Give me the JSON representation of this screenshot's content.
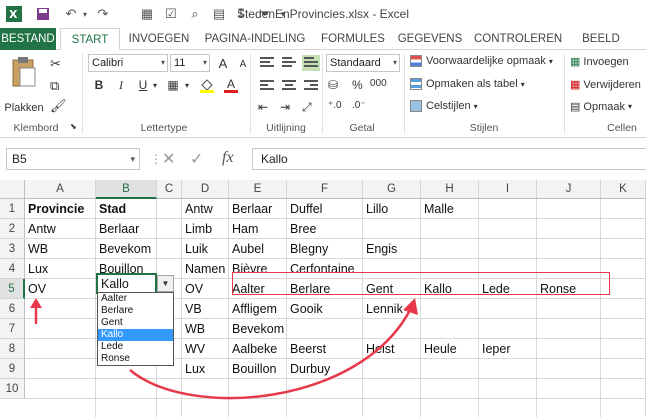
{
  "window": {
    "title": "StedenEnProvincies.xlsx - Excel"
  },
  "qat": {
    "icons": [
      "excel-logo-icon",
      "save-icon",
      "undo-icon",
      "redo-icon",
      "sort-icon",
      "format-icon",
      "preview-icon",
      "paste-special-icon",
      "sort-desc-icon",
      "filter-icon",
      "customize-icon"
    ]
  },
  "tabs": [
    {
      "label": "BESTAND"
    },
    {
      "label": "START"
    },
    {
      "label": "INVOEGEN"
    },
    {
      "label": "PAGINA-INDELING"
    },
    {
      "label": "FORMULES"
    },
    {
      "label": "GEGEVENS"
    },
    {
      "label": "CONTROLEREN"
    },
    {
      "label": "BEELD"
    }
  ],
  "ribbon": {
    "clipboard": {
      "paste_label": "Plakken",
      "group_label": "Klembord"
    },
    "font": {
      "name": "Calibri",
      "size": "11",
      "bold": "B",
      "italic": "I",
      "underline": "U",
      "grow": "A",
      "shrink": "A",
      "fontcolor": "A",
      "group_label": "Lettertype"
    },
    "alignment": {
      "group_label": "Uitlijning"
    },
    "number": {
      "format": "Standaard",
      "percent": "%",
      "thousands": "000",
      "group_label": "Getal"
    },
    "styles": {
      "conditional": "Voorwaardelijke opmaak",
      "as_table": "Opmaken als tabel",
      "cell_styles": "Celstijlen",
      "group_label": "Stijlen"
    },
    "cells": {
      "insert": "Invoegen",
      "delete": "Verwijderen",
      "format": "Opmaak",
      "group_label": "Cellen"
    }
  },
  "formula_bar": {
    "name_box": "B5",
    "fx": "fx",
    "value": "Kallo"
  },
  "columns": [
    "A",
    "B",
    "C",
    "D",
    "E",
    "F",
    "G",
    "H",
    "I",
    "J",
    "K"
  ],
  "rows": [
    "1",
    "2",
    "3",
    "4",
    "5",
    "6",
    "7",
    "8",
    "9",
    "10"
  ],
  "cells": {
    "A": [
      "Provincie",
      "Antw",
      "WB",
      "Lux",
      "OV",
      "",
      "",
      "",
      "",
      ""
    ],
    "B": [
      "Stad",
      "Berlaar",
      "Bevekom",
      "Bouillon",
      "Kallo",
      "",
      "",
      "",
      "",
      ""
    ],
    "D": [
      "Antw",
      "Limb",
      "Luik",
      "Namen",
      "OV",
      "VB",
      "WB",
      "WV",
      "Lux",
      ""
    ],
    "E": [
      "Berlaar",
      "Ham",
      "Aubel",
      "Bièvre",
      "Aalter",
      "Affligem",
      "Bevekom",
      "Aalbeke",
      "Bouillon",
      ""
    ],
    "F": [
      "Duffel",
      "Bree",
      "Blegny",
      "Cerfontaine",
      "Berlare",
      "Gooik",
      "",
      "Beerst",
      "Durbuy",
      ""
    ],
    "G": [
      "Lillo",
      "",
      "Engis",
      "",
      "Gent",
      "Lennik",
      "",
      "Heist",
      "",
      ""
    ],
    "H": [
      "Malle",
      "",
      "",
      "",
      "Kallo",
      "",
      "",
      "Heule",
      "",
      ""
    ],
    "I": [
      "",
      "",
      "",
      "",
      "Lede",
      "",
      "",
      "Ieper",
      "",
      ""
    ],
    "J": [
      "",
      "",
      "",
      "",
      "Ronse",
      "",
      "",
      "",
      "",
      ""
    ]
  },
  "dropdown": {
    "options": [
      "Aalter",
      "Berlare",
      "Gent",
      "Kallo",
      "Lede",
      "Ronse"
    ],
    "selected": "Kallo"
  },
  "colors": {
    "excel_green": "#217346",
    "annotation_red": "#e8394a",
    "selection_blue": "#3399ff"
  }
}
